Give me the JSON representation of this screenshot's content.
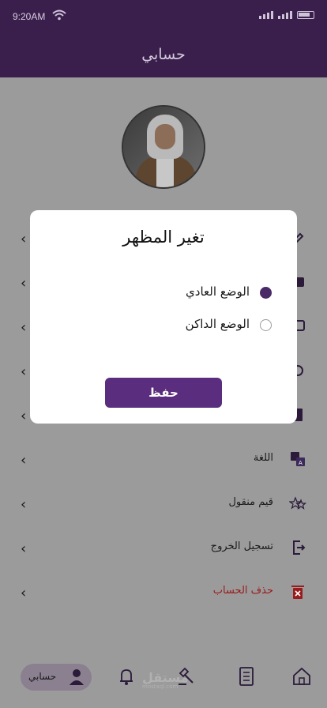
{
  "status_bar": {
    "time": "9:20AM"
  },
  "header": {
    "title": "حسابي"
  },
  "menu": [
    {
      "label": "",
      "icon": "edit-icon"
    },
    {
      "label": "",
      "icon": "wallet-icon"
    },
    {
      "label": "",
      "icon": "chat-icon"
    },
    {
      "label": "",
      "icon": "theme-icon"
    },
    {
      "label": "",
      "icon": "document-icon"
    },
    {
      "label": "اللغة",
      "icon": "language-icon"
    },
    {
      "label": "قيم منقول",
      "icon": "stars-icon"
    },
    {
      "label": "تسجيل الخروج",
      "icon": "logout-icon"
    },
    {
      "label": "حذف الحساب",
      "icon": "trash-icon",
      "color": "#9a1b1b"
    }
  ],
  "dialog": {
    "title": "تغير المظهر",
    "options": [
      {
        "label": "الوضع العادي",
        "checked": true
      },
      {
        "label": "الوضع الداكن",
        "checked": false
      }
    ],
    "save_label": "حفظ"
  },
  "bottom_nav": {
    "profile_label": "حسابي",
    "items": [
      "home-icon",
      "orders-icon",
      "auction-icon",
      "bell-icon"
    ]
  },
  "watermark": {
    "brand": "مستقل",
    "url": "mostaql.com"
  },
  "colors": {
    "primary": "#3a1f4d",
    "button": "#5a2d7e",
    "danger": "#9a1b1b"
  }
}
